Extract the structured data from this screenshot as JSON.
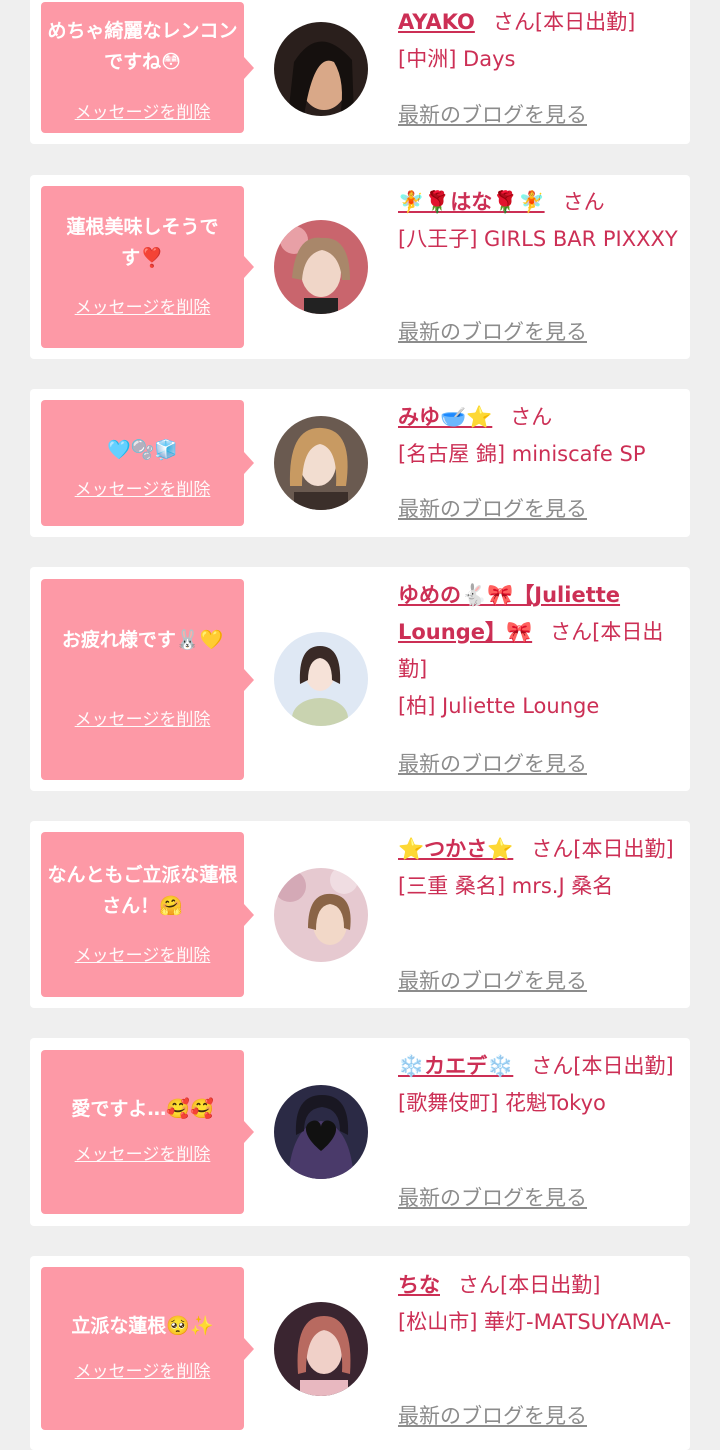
{
  "delete_label": "メッセージを削除",
  "blog_label": "最新のブログを見る",
  "san_suffix": "さん",
  "colors": {
    "bubble": "#fd99a6",
    "name": "#cc2f55",
    "blog": "#8c8c8c",
    "background": "#efefef"
  },
  "messages": [
    {
      "text": "めちゃ綺麗なレンコンですね😳",
      "name": "AYAKO",
      "status": "[本日出勤]",
      "shop": "[中洲] Days"
    },
    {
      "text": "蓮根美味しそうです❣️",
      "name": "🧚🌹はな🌹🧚",
      "status": "",
      "shop": "[八王子] GIRLS BAR PIXXXY"
    },
    {
      "text": "🩵🫧🧊",
      "name": "みゆ🥣⭐",
      "status": "",
      "shop": "[名古屋 錦] miniscafe SP"
    },
    {
      "text": "お疲れ様です🐰💛",
      "name": "ゆめの🐇🎀【Juliette Lounge】🎀",
      "status": "[本日出勤]",
      "shop": "[柏] Juliette Lounge"
    },
    {
      "text": "なんともご立派な蓮根さん！🤗",
      "name": "⭐つかさ⭐",
      "status": "[本日出勤]",
      "shop": "[三重 桑名] mrs.J 桑名"
    },
    {
      "text": "愛ですよ…🥰🥰",
      "name": "❄️カエデ❄️",
      "status": "[本日出勤]",
      "shop": "[歌舞伎町] 花魁Tokyo"
    },
    {
      "text": "立派な蓮根🥺✨",
      "name": "ちな",
      "status": "[本日出勤]",
      "shop": "[松山市] 華灯-MATSUYAMA-"
    }
  ]
}
